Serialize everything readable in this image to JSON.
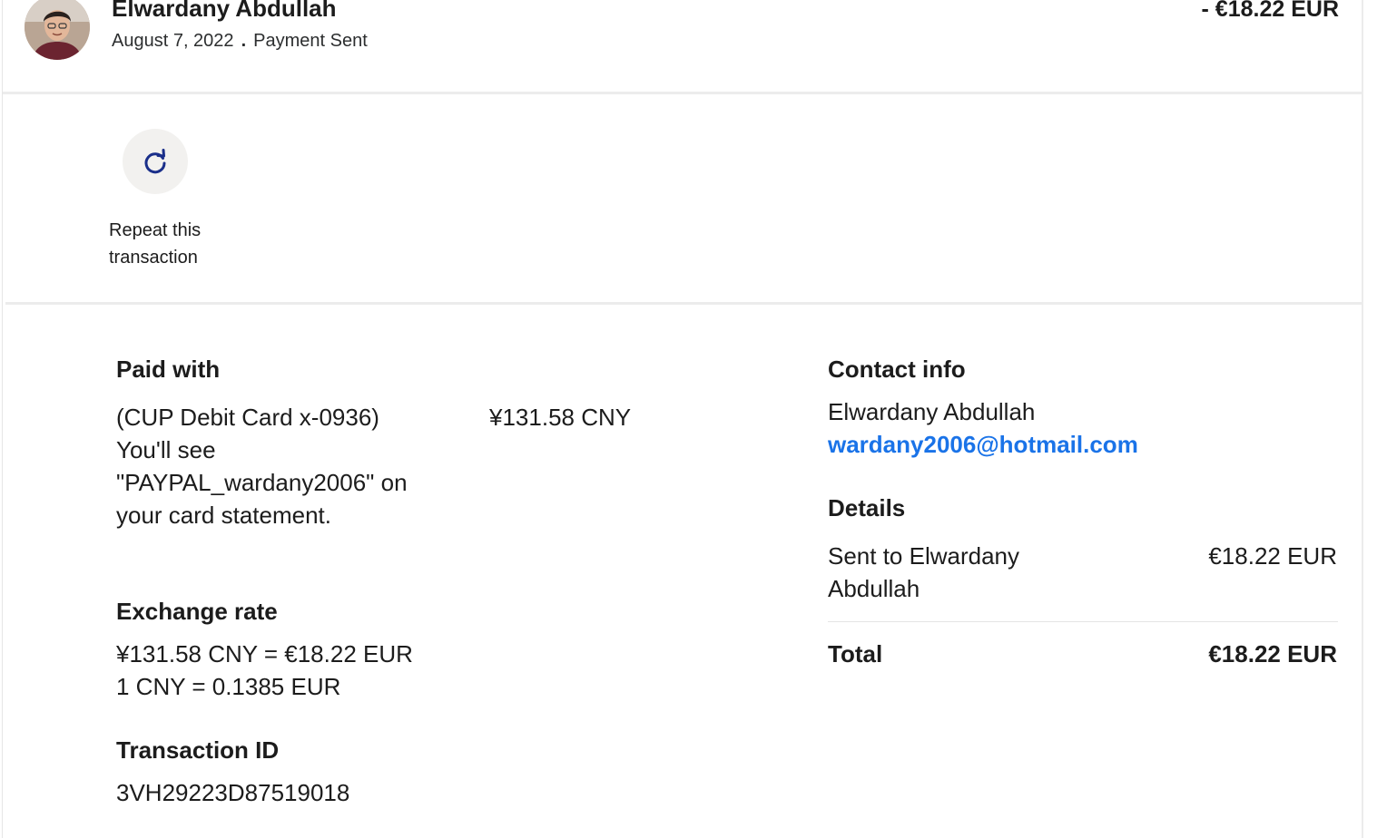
{
  "header": {
    "name": "Elwardany Abdullah",
    "date": "August 7, 2022",
    "separator": ".",
    "status": "Payment Sent",
    "amount": "- €18.22 EUR"
  },
  "actions": {
    "repeat_label": "Repeat this transaction",
    "repeat_icon": "refresh-icon"
  },
  "paid_with": {
    "title": "Paid with",
    "description": "(CUP Debit Card x-0936) You'll see \"PAYPAL_wardany2006\" on your card statement.",
    "amount": "¥131.58 CNY"
  },
  "exchange_rate": {
    "title": "Exchange rate",
    "line1": "¥131.58 CNY = €18.22 EUR",
    "line2": "1 CNY = 0.1385 EUR"
  },
  "transaction": {
    "title": "Transaction ID",
    "id": "3VH29223D87519018"
  },
  "contact": {
    "title": "Contact info",
    "name": "Elwardany Abdullah",
    "email": "wardany2006@hotmail.com"
  },
  "details": {
    "title": "Details",
    "sent_to_label": "Sent to Elwardany Abdullah",
    "sent_to_amount": "€18.22 EUR",
    "total_label": "Total",
    "total_amount": "€18.22 EUR"
  },
  "colors": {
    "link": "#1a73e8",
    "icon": "#1a2f8a",
    "divider": "#ececec"
  }
}
